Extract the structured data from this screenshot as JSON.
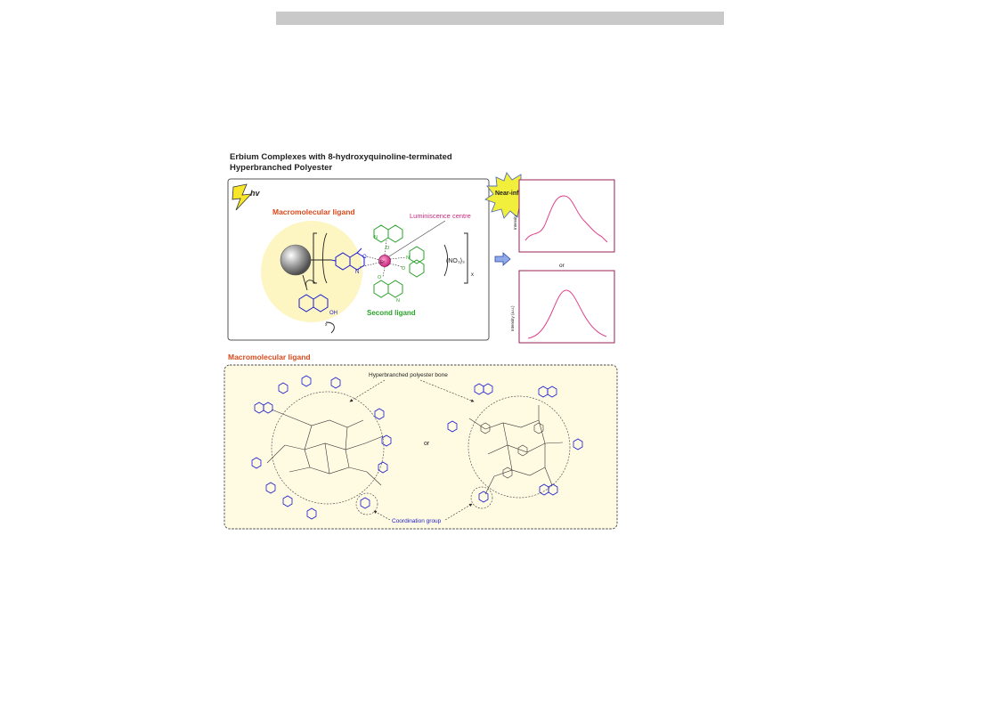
{
  "figure": {
    "title_line1": "Erbium Complexes with 8-hydroxyquinoline-terminated",
    "title_line2": "Hyperbranched Polyester"
  },
  "top_panel": {
    "hv": "hv",
    "macromolecular_ligand": "Macromolecular ligand",
    "luminiscence_centre": "Luminiscence centre",
    "second_ligand": "Second ligand",
    "near_infrared": "Near-infrared",
    "nitrate": "(NO₃)₃",
    "subscript_x": "x",
    "er_label": "Er",
    "oh": "OH",
    "n": "N",
    "o": "O",
    "or": "or",
    "y_axis_top": "Intensity",
    "y_axis_bottom": "Intensity (a.u.)"
  },
  "bottom_panel": {
    "title": "Macromolecular ligand",
    "backbone_label": "Hyperbranched polyester bone",
    "coordination_label": "Coordination group",
    "or": "or"
  },
  "colors": {
    "orange_label": "#d9491c",
    "magenta": "#c8287d",
    "green": "#2aa32a",
    "blue": "#1a1acc",
    "panel_fill": "#fffbe3",
    "circle_fill": "#fdf6c3",
    "starburst": "#f2ef3c",
    "spectrum": "#e0408a"
  }
}
